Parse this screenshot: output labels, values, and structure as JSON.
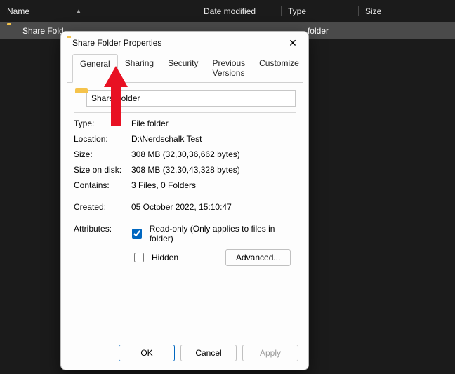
{
  "explorer": {
    "columns": {
      "name": "Name",
      "date": "Date modified",
      "type": "Type",
      "size": "Size"
    },
    "row": {
      "name": "Share Fold",
      "type": "folder"
    }
  },
  "dialog": {
    "title": "Share Folder Properties",
    "tabs": {
      "general": "General",
      "sharing": "Sharing",
      "security": "Security",
      "previous": "Previous Versions",
      "customize": "Customize"
    },
    "folder_name": "Share Folder",
    "fields": {
      "type_label": "Type:",
      "type_value": "File folder",
      "location_label": "Location:",
      "location_value": "D:\\Nerdschalk Test",
      "size_label": "Size:",
      "size_value": "308 MB (32,30,36,662 bytes)",
      "sizeondisk_label": "Size on disk:",
      "sizeondisk_value": "308 MB (32,30,43,328 bytes)",
      "contains_label": "Contains:",
      "contains_value": "3 Files, 0 Folders",
      "created_label": "Created:",
      "created_value": "05 October 2022, 15:10:47",
      "attributes_label": "Attributes:",
      "readonly_label": "Read-only (Only applies to files in folder)",
      "hidden_label": "Hidden",
      "advanced_label": "Advanced..."
    },
    "buttons": {
      "ok": "OK",
      "cancel": "Cancel",
      "apply": "Apply"
    }
  }
}
